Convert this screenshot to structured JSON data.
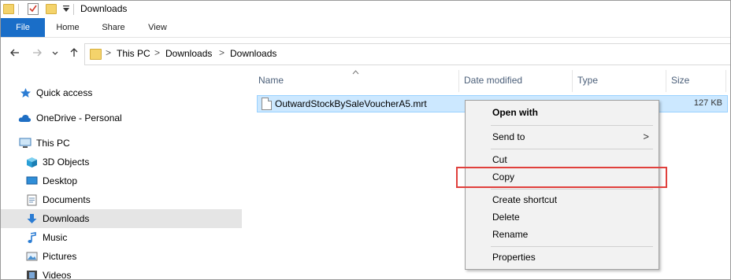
{
  "window": {
    "title": "Downloads"
  },
  "ribbon": {
    "tabs": [
      "File",
      "Home",
      "Share",
      "View"
    ]
  },
  "address": {
    "crumbs": [
      "This PC",
      "Downloads",
      "Downloads"
    ],
    "separator": ">"
  },
  "nav_icons": {
    "back": "back-arrow-icon",
    "forward": "forward-arrow-icon",
    "recent": "chevron-down-icon",
    "up": "up-arrow-icon"
  },
  "nav_pane": {
    "items": [
      {
        "label": "Quick access",
        "icon": "star-icon"
      },
      {
        "label": "OneDrive - Personal",
        "icon": "cloud-icon"
      },
      {
        "label": "This PC",
        "icon": "computer-icon"
      },
      {
        "label": "3D Objects",
        "icon": "cube-icon"
      },
      {
        "label": "Desktop",
        "icon": "desktop-icon"
      },
      {
        "label": "Documents",
        "icon": "document-icon"
      },
      {
        "label": "Downloads",
        "icon": "download-arrow-icon",
        "selected": true
      },
      {
        "label": "Music",
        "icon": "music-note-icon"
      },
      {
        "label": "Pictures",
        "icon": "picture-icon"
      },
      {
        "label": "Videos",
        "icon": "film-icon"
      }
    ]
  },
  "columns": [
    "Name",
    "Date modified",
    "Type",
    "Size"
  ],
  "files": [
    {
      "name": "OutwardStockBySaleVoucherA5.mrt",
      "size": "127 KB"
    }
  ],
  "context_menu": {
    "items": [
      {
        "label": "Open with",
        "bold": true
      },
      {
        "label": "Send to",
        "submenu_arrow": ">"
      },
      {
        "label": "Cut"
      },
      {
        "label": "Copy",
        "highlighted": true
      },
      {
        "label": "Create shortcut"
      },
      {
        "label": "Delete"
      },
      {
        "label": "Rename"
      },
      {
        "label": "Properties"
      }
    ]
  },
  "colors": {
    "file_tab": "#1a6ec8",
    "selection": "#cce8ff",
    "highlight_box": "#e0403c",
    "folder": "#f4d36b"
  }
}
